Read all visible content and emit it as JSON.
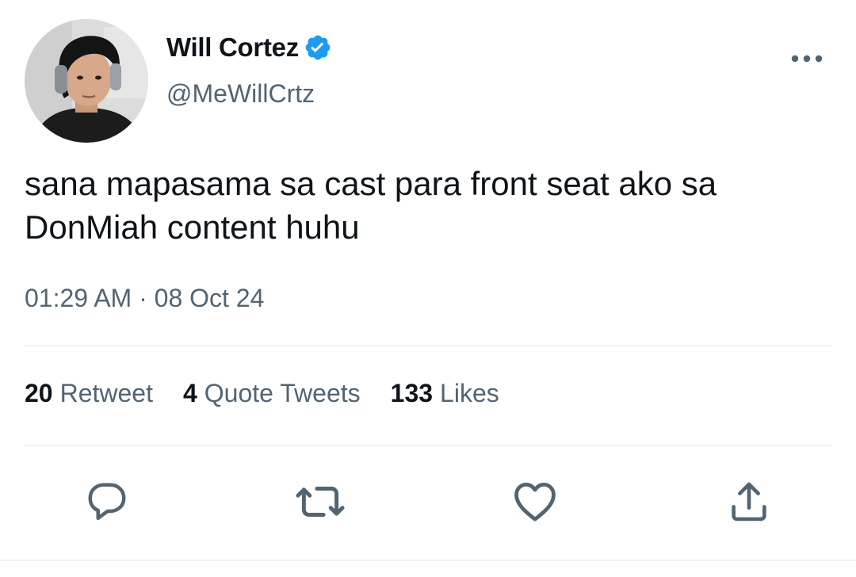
{
  "tweet": {
    "author": {
      "display_name": "Will Cortez",
      "handle": "@MeWillCrtz",
      "verified": true
    },
    "text": "sana mapasama sa cast para front seat ako sa\nDonMiah content huhu",
    "timestamp": "01:29 AM · 08 Oct 24",
    "stats": {
      "retweets": "20",
      "retweets_label": "Retweet",
      "quotes": "4",
      "quotes_label": "Quote Tweets",
      "likes": "133",
      "likes_label": "Likes"
    },
    "actions": [
      "reply-icon",
      "retweet-icon",
      "like-icon",
      "share-icon"
    ]
  },
  "colors": {
    "text_primary": "#0f1419",
    "text_secondary": "#536471",
    "verified_blue": "#1d9bf0",
    "divider": "#eff3f4"
  }
}
